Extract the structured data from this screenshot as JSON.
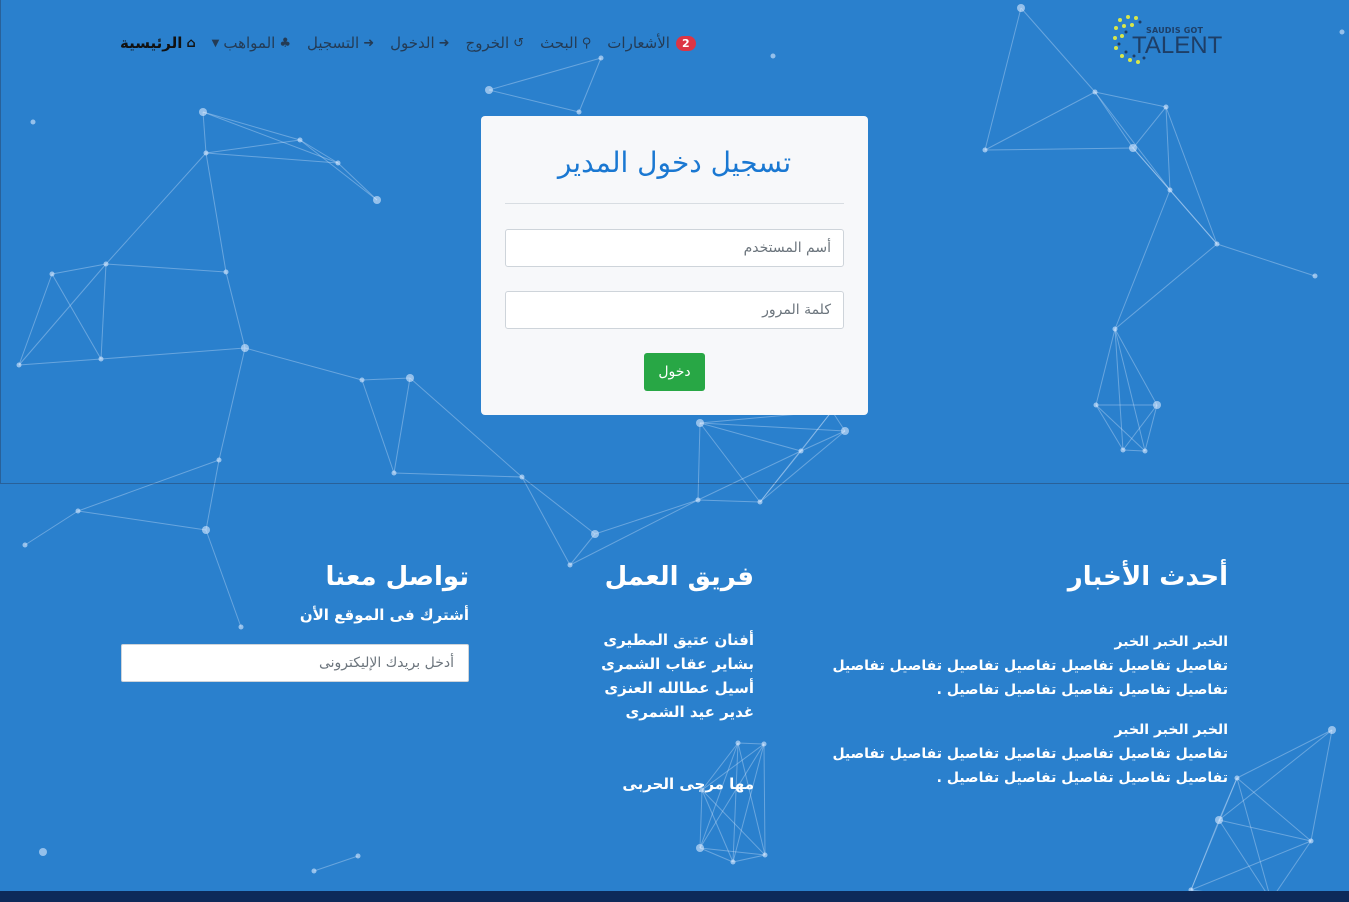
{
  "logo": {
    "small_text": "SAUDIS GOT",
    "big_text": "TALENT"
  },
  "nav": {
    "home": "الرئيسية",
    "talents": "المواهب",
    "register": "التسجيل",
    "login": "الدخول",
    "logout": "الخروج",
    "search": "البحث",
    "notifications": "الأشعارات",
    "notifications_count": "2"
  },
  "login_card": {
    "title": "تسجيل دخول المدير",
    "username_placeholder": "أسم المستخدم",
    "password_placeholder": "كلمة المرور",
    "submit_label": "دخول"
  },
  "news": {
    "title": "أحدث الأخبار",
    "items": [
      {
        "headline": "الخبر الخبر الخبر",
        "body": "تفاصيل تفاصيل تفاصيل تفاصيل تفاصيل تفاصيل تفاصيل تفاصيل تفاصيل تفاصيل تفاصيل تفاصيل ."
      },
      {
        "headline": "الخبر الخبر الخبر",
        "body": "تفاصيل تفاصيل تفاصيل تفاصيل تفاصيل تفاصيل تفاصيل تفاصيل تفاصيل تفاصيل تفاصيل تفاصيل ."
      }
    ]
  },
  "team": {
    "title": "فريق العمل",
    "members": [
      "أفنان عتيق المطيرى",
      "بشاير عقاب الشمرى",
      "أسيل عطالله العنزى",
      "غدير عيد الشمرى",
      "مها مرجى الحربى"
    ]
  },
  "contact": {
    "title": "تواصل معنا",
    "subtitle": "أشترك فى الموقع الأن",
    "email_placeholder": "أدخل بريدك الإليكترونى"
  },
  "colors": {
    "background": "#2a80cd",
    "accent": "#1a78d2",
    "success": "#28a745",
    "badge": "#dc3545"
  }
}
